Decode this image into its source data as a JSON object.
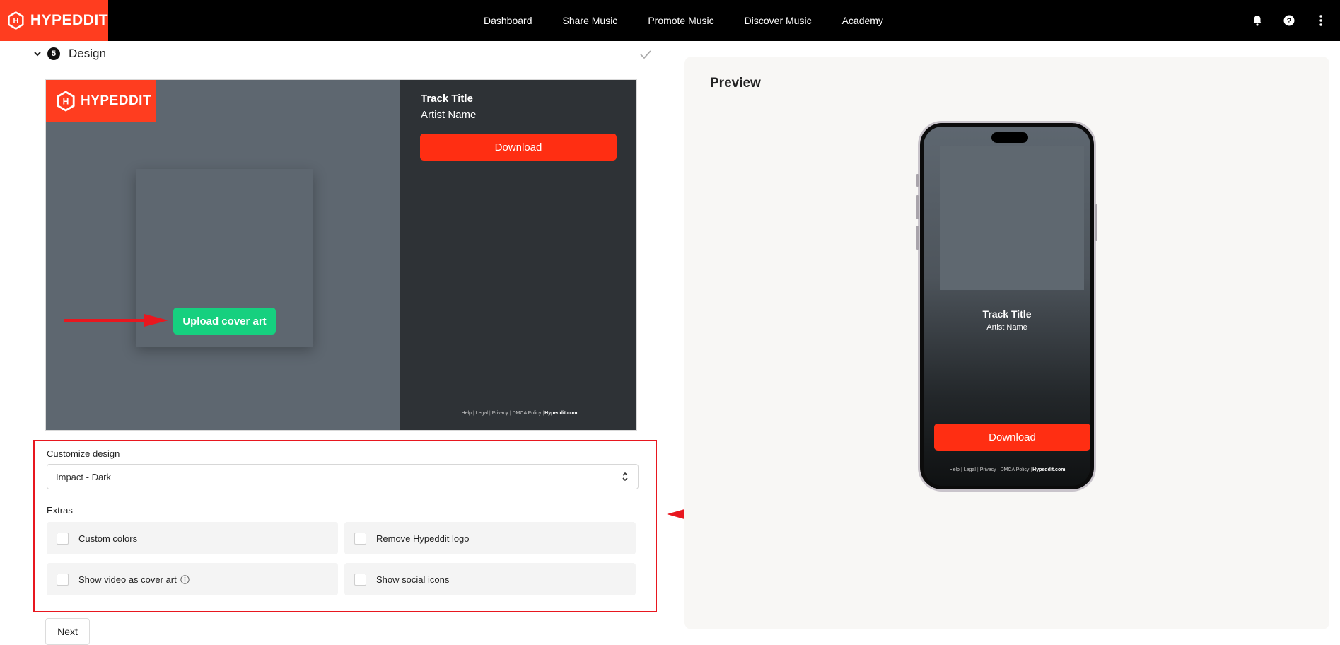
{
  "nav": {
    "logo_text": "HYPEDDIT",
    "links": [
      "Dashboard",
      "Share Music",
      "Promote Music",
      "Discover Music",
      "Academy"
    ],
    "icons": [
      "bell-icon",
      "help-icon",
      "more-vert-icon"
    ]
  },
  "step": {
    "number": "5",
    "title": "Design"
  },
  "design_card": {
    "logo_text": "HYPEDDIT",
    "upload_label": "Upload cover art",
    "track_title": "Track Title",
    "artist_name": "Artist Name",
    "download_label": "Download",
    "footer_links": [
      "Help",
      "Legal",
      "Privacy",
      "DMCA Policy"
    ],
    "footer_brand": "Hypeddit.com"
  },
  "customize": {
    "label": "Customize design",
    "selected": "Impact - Dark",
    "extras_label": "Extras",
    "options": [
      "Custom colors",
      "Remove Hypeddit logo",
      "Show video as cover art",
      "Show social icons"
    ]
  },
  "next_label": "Next",
  "preview": {
    "title": "Preview",
    "track_title": "Track Title",
    "artist_name": "Artist Name",
    "download_label": "Download",
    "footer_links": [
      "Help",
      "Legal",
      "Privacy",
      "DMCA Policy"
    ],
    "footer_brand": "Hypeddit.com"
  },
  "colors": {
    "brand": "#ff3d1f",
    "download": "#ff2e12",
    "upload": "#16d07f",
    "annotation": "#e8171f"
  }
}
